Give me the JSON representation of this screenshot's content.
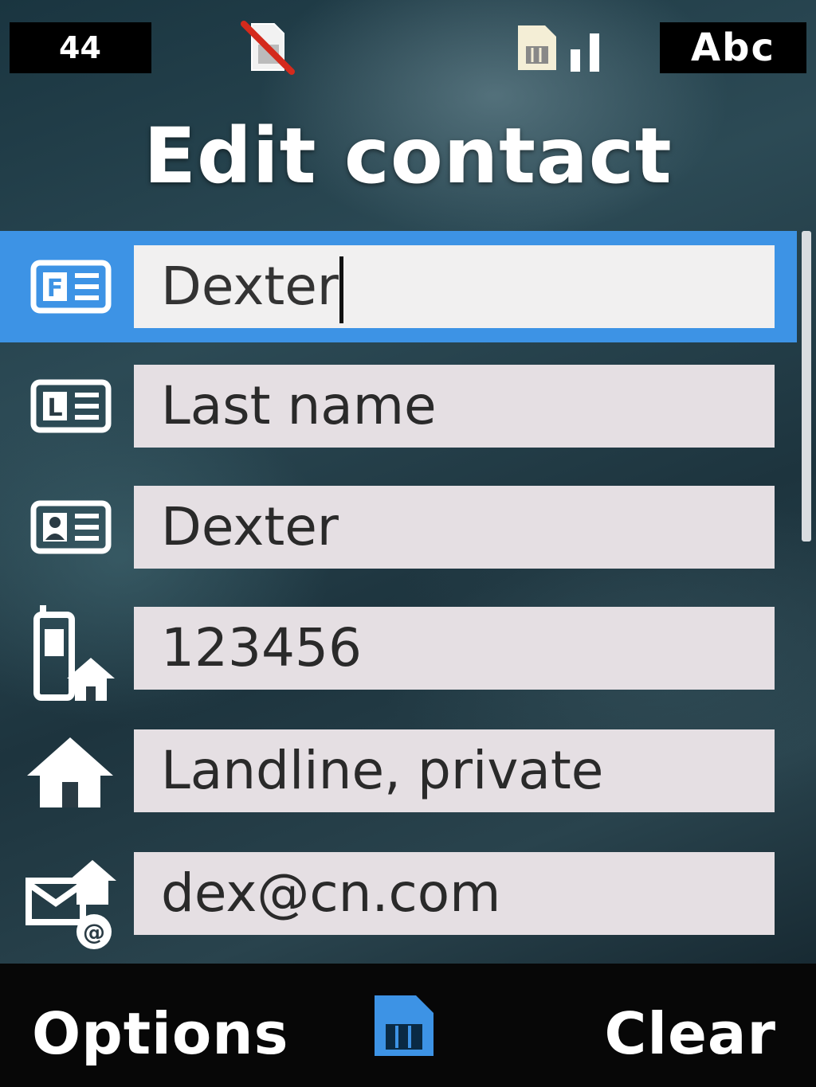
{
  "status": {
    "indicator": "44",
    "input_mode": "Abc",
    "icons": [
      "no-memory-card-icon",
      "sim-card-icon",
      "signal-icon"
    ]
  },
  "title": "Edit contact",
  "fields": [
    {
      "icon": "first-name-card-icon",
      "value": "Dexter",
      "selected": true
    },
    {
      "icon": "last-name-card-icon",
      "placeholder": "Last name"
    },
    {
      "icon": "display-name-card-icon",
      "value": "Dexter"
    },
    {
      "icon": "mobile-home-icon",
      "value": "123456"
    },
    {
      "icon": "home-icon",
      "placeholder": "Landline, private"
    },
    {
      "icon": "email-home-icon",
      "value": "dex@cn.com"
    }
  ],
  "softkeys": {
    "left": "Options",
    "center_icon": "sim-card-icon",
    "right": "Clear"
  },
  "colors": {
    "selection": "#3d93e5",
    "field": "#e5dfe3",
    "field_selected": "#f1f0f0",
    "softkey_bar": "#070707"
  }
}
